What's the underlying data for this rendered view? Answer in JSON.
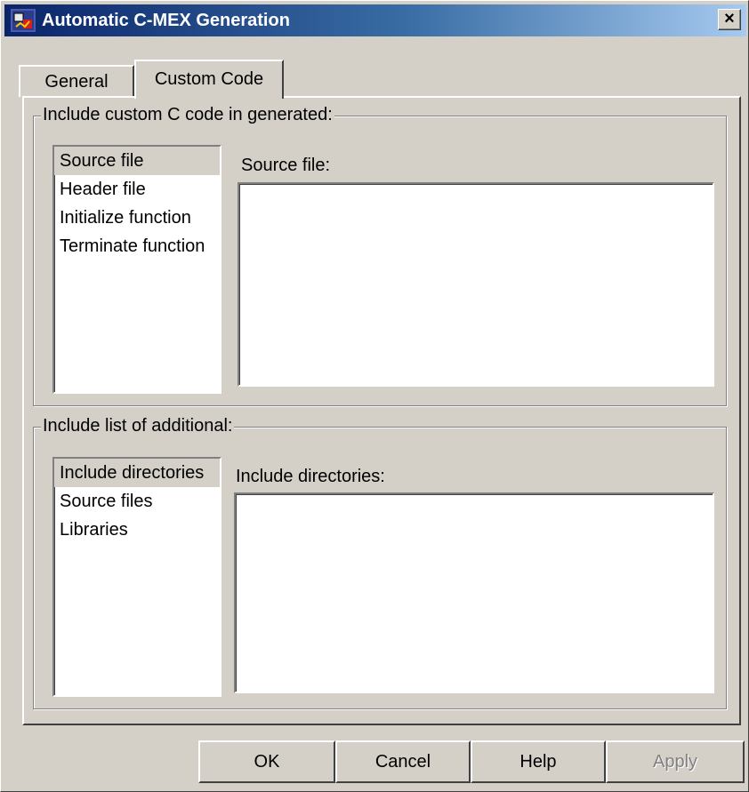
{
  "window": {
    "title": "Automatic C-MEX Generation",
    "close_label": "×"
  },
  "tabs": [
    {
      "label": "General",
      "selected": false
    },
    {
      "label": "Custom Code",
      "selected": true
    }
  ],
  "custom_code_group": {
    "title": "Include custom C code in generated:",
    "items": [
      "Source file",
      "Header file",
      "Initialize function",
      "Terminate function"
    ],
    "selected_item": "Source file",
    "field_label": "Source file:",
    "field_value": ""
  },
  "additional_group": {
    "title": "Include list of additional:",
    "items": [
      "Include directories",
      "Source files",
      "Libraries"
    ],
    "selected_item": "Include directories",
    "field_label": "Include directories:",
    "field_value": ""
  },
  "buttons": {
    "ok": "OK",
    "cancel": "Cancel",
    "help": "Help",
    "apply": "Apply"
  },
  "colors": {
    "titlebar_start": "#0a246a",
    "titlebar_end": "#a6caf0",
    "face": "#d4d0c8"
  },
  "icons": [
    "simulink-app-icon",
    "close-icon"
  ]
}
